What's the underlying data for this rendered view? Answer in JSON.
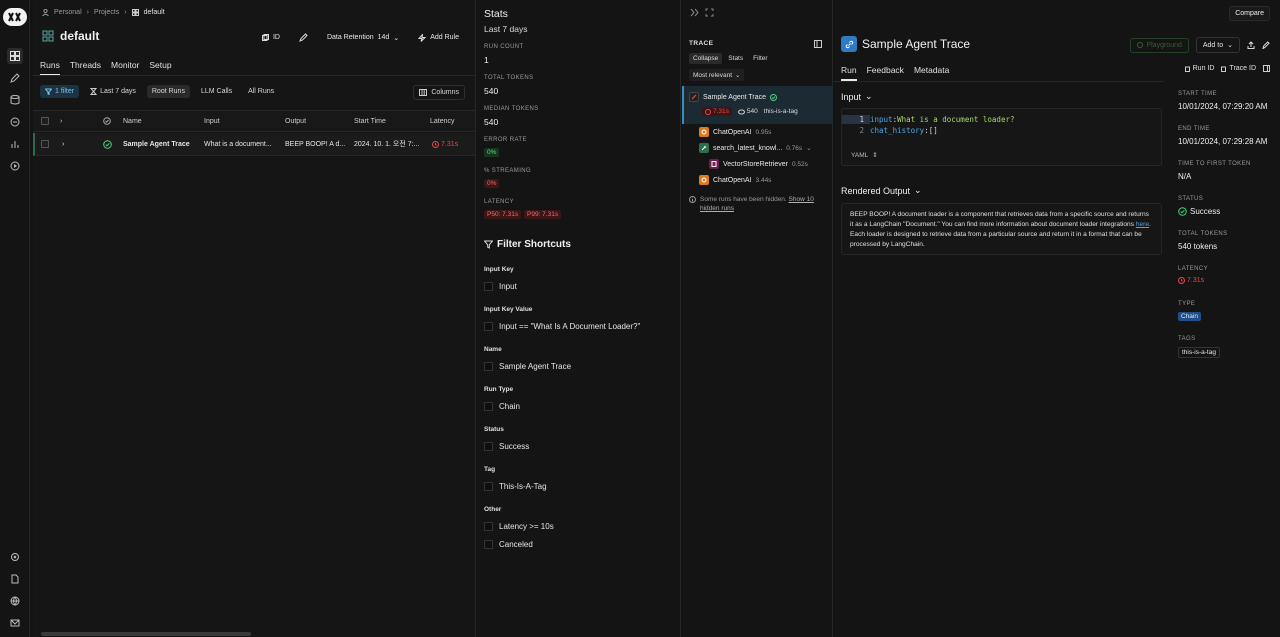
{
  "breadcrumb": {
    "root": "Personal",
    "projects": "Projects",
    "current": "default"
  },
  "project": {
    "title": "default",
    "id_label": "ID",
    "retention_label": "Data Retention",
    "retention_value": "14d",
    "add_rule": "Add Rule"
  },
  "tabs": [
    "Runs",
    "Threads",
    "Monitor",
    "Setup"
  ],
  "filters": {
    "filter_chip": "1 filter",
    "date_range": "Last 7 days",
    "segments": [
      "Root Runs",
      "LLM Calls",
      "All Runs"
    ],
    "columns": "Columns"
  },
  "table": {
    "headers": {
      "name": "Name",
      "input": "Input",
      "output": "Output",
      "start_time": "Start Time",
      "latency": "Latency"
    },
    "row": {
      "name": "Sample Agent Trace",
      "input": "What is a document...",
      "output": "BEEP BOOP! A d...",
      "start_time": "2024. 10. 1. 오전 7:...",
      "latency": "7.31s"
    }
  },
  "stats": {
    "title": "Stats",
    "subtitle": "Last 7 days",
    "run_count_label": "RUN COUNT",
    "run_count": "1",
    "total_tokens_label": "TOTAL TOKENS",
    "total_tokens": "540",
    "median_tokens_label": "MEDIAN TOKENS",
    "median_tokens": "540",
    "error_rate_label": "ERROR RATE",
    "error_rate": "0%",
    "streaming_label": "% STREAMING",
    "streaming": "0%",
    "latency_label": "LATENCY",
    "p50": "P50: 7.31s",
    "p99": "P99: 7.31s"
  },
  "filter_shortcuts": {
    "title": "Filter Shortcuts",
    "groups": [
      {
        "label": "Input Key",
        "options": [
          "Input"
        ]
      },
      {
        "label": "Input Key Value",
        "options": [
          "Input == \"What Is A Document Loader?\""
        ]
      },
      {
        "label": "Name",
        "options": [
          "Sample Agent Trace"
        ]
      },
      {
        "label": "Run Type",
        "options": [
          "Chain"
        ]
      },
      {
        "label": "Status",
        "options": [
          "Success"
        ]
      },
      {
        "label": "Tag",
        "options": [
          "This-Is-A-Tag"
        ]
      },
      {
        "label": "Other",
        "options": [
          "Latency >= 10s",
          "Canceled"
        ]
      }
    ]
  },
  "trace": {
    "title": "TRACE",
    "buttons": [
      "Collapse",
      "Stats",
      "Filter"
    ],
    "sort": "Most relevant",
    "root": {
      "name": "Sample Agent Trace",
      "latency": "7.31s",
      "tokens": "540",
      "tag": "this-is-a-tag"
    },
    "children": [
      {
        "name": "ChatOpenAI",
        "time": "0.95s"
      },
      {
        "name": "search_latest_knowl...",
        "time": "0.76s"
      },
      {
        "name": "VectorStoreRetriever",
        "time": "0.52s"
      },
      {
        "name": "ChatOpenAI",
        "time": "3.44s"
      }
    ],
    "hidden_note": "Some runs have been hidden.",
    "hidden_link": "Show 10 hidden runs"
  },
  "detail": {
    "compare": "Compare",
    "title": "Sample Agent Trace",
    "playground": "Playground",
    "add_to": "Add to",
    "tabs": [
      "Run",
      "Feedback",
      "Metadata"
    ],
    "run_id": "Run ID",
    "trace_id": "Trace ID",
    "input_heading": "Input",
    "code": [
      {
        "n": "1",
        "key": "input",
        "val": "What is a document loader?"
      },
      {
        "n": "2",
        "key": "chat_history",
        "val": "[]"
      }
    ],
    "format": "YAML",
    "output_heading": "Rendered Output",
    "output_pre": "BEEP BOOP! A document loader is a component that retrieves data from a specific source and returns it as a LangChain \"Document.\" You can find more information about document loader integrations ",
    "output_link": "here",
    "output_post": ". Each loader is designed to retrieve data from a particular source and return it in a format that can be processed by LangChain.",
    "meta": {
      "start_label": "START TIME",
      "start": "10/01/2024, 07:29:20 AM",
      "end_label": "END TIME",
      "end": "10/01/2024, 07:29:28 AM",
      "ttft_label": "TIME TO FIRST TOKEN",
      "ttft": "N/A",
      "status_label": "STATUS",
      "status": "Success",
      "tokens_label": "TOTAL TOKENS",
      "tokens": "540 tokens",
      "latency_label": "LATENCY",
      "latency": "7.31s",
      "type_label": "TYPE",
      "type": "Chain",
      "tags_label": "TAGS",
      "tag": "this-is-a-tag"
    }
  }
}
